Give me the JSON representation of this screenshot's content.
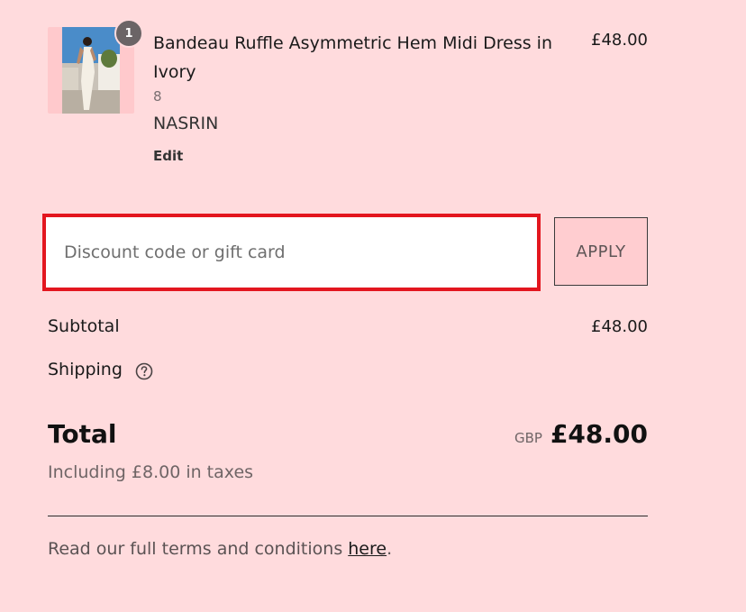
{
  "item": {
    "quantity": "1",
    "title": "Bandeau Ruffle Asymmetric Hem Midi Dress in Ivory",
    "size": "8",
    "brand": "NASRIN",
    "edit_label": "Edit",
    "price": "£48.00"
  },
  "discount": {
    "placeholder": "Discount code or gift card",
    "value": "",
    "apply_label": "APPLY"
  },
  "summary": {
    "subtotal_label": "Subtotal",
    "subtotal_value": "£48.00",
    "shipping_label": "Shipping",
    "shipping_help_icon": "question-circle-icon",
    "total_label": "Total",
    "total_currency": "GBP",
    "total_value": "£48.00",
    "taxes_note": "Including £8.00 in taxes"
  },
  "footer": {
    "terms_prefix": "Read our full terms and conditions ",
    "terms_link": "here",
    "terms_suffix": "."
  },
  "colors": {
    "background": "#ffdbdd",
    "discount_highlight": "#e3161f",
    "apply_button_bg": "#ffcdd0",
    "badge_bg": "#6b6466"
  }
}
